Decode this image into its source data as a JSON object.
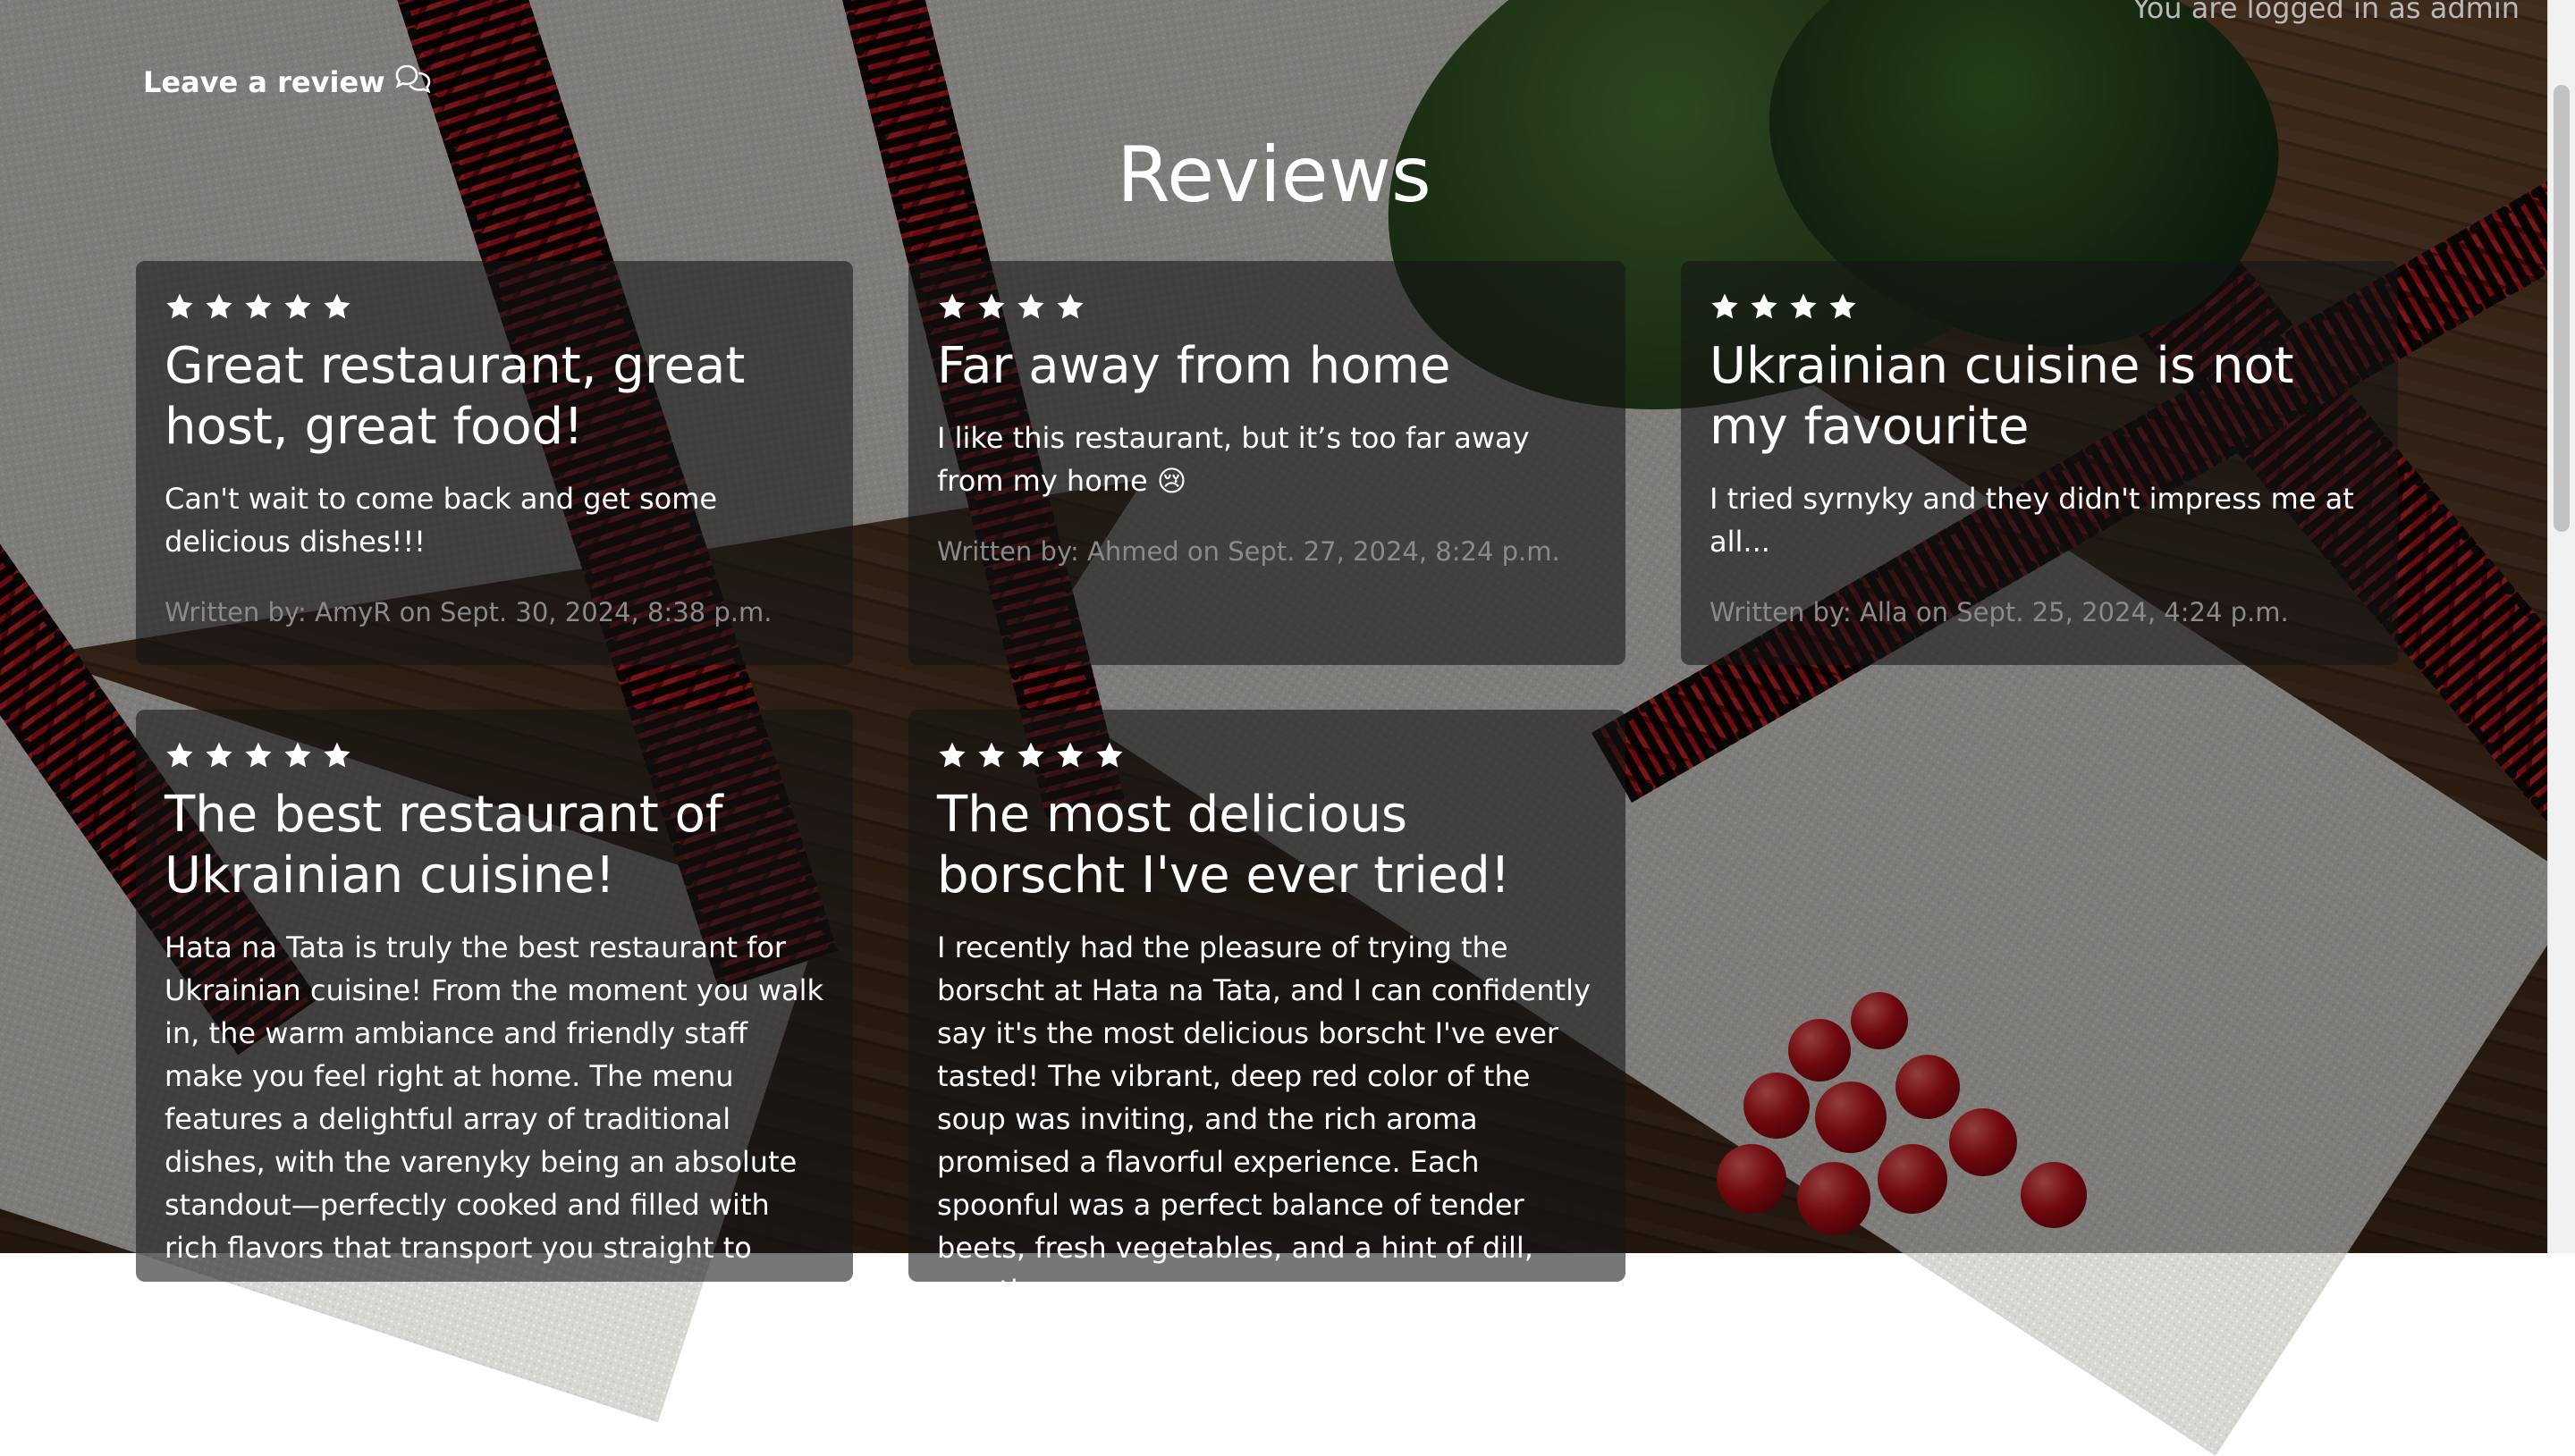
{
  "header": {
    "login_status": "You are logged in as admin",
    "leave_review_label": "Leave a review",
    "page_title": "Reviews"
  },
  "reviews": [
    {
      "rating": 5,
      "title": "Great restaurant, great host, great food!",
      "body": "Can't wait to come back and get some delicious dishes!!!",
      "meta": "Written by: AmyR on Sept. 30, 2024, 8:38 p.m."
    },
    {
      "rating": 4,
      "title": "Far away from home",
      "body": "I like this restaurant, but it’s too far away from my home 😢",
      "meta": "Written by: Ahmed on Sept. 27, 2024, 8:24 p.m."
    },
    {
      "rating": 4,
      "title": "Ukrainian cuisine is not my favourite",
      "body": "I tried syrnyky and they didn't impress me at all...",
      "meta": "Written by: Alla on Sept. 25, 2024, 4:24 p.m."
    },
    {
      "rating": 5,
      "title": "The best restaurant of Ukrainian cuisine!",
      "body": "Hata na Tata is truly the best restaurant for Ukrainian cuisine! From the moment you walk in, the warm ambiance and friendly staff make you feel right at home. The menu features a delightful array of traditional dishes, with the varenyky being an absolute standout—perfectly cooked and filled with rich flavors that transport you straight to",
      "meta": ""
    },
    {
      "rating": 5,
      "title": "The most delicious borscht I've ever tried!",
      "body": "I recently had the pleasure of trying the borscht at Hata na Tata, and I can confidently say it's the most delicious borscht I've ever tasted! The vibrant, deep red color of the soup was inviting, and the rich aroma promised a flavorful experience. Each spoonful was a perfect balance of tender beets, fresh vegetables, and a hint of dill, creating a",
      "meta": ""
    }
  ],
  "colors": {
    "star": "#ffffff",
    "meta_text": "#8a8a8a",
    "card_bg": "rgba(20,20,20,0.58)"
  },
  "icons": {
    "leave_review": "chat-bubbles-icon",
    "rating": "star-icon"
  }
}
